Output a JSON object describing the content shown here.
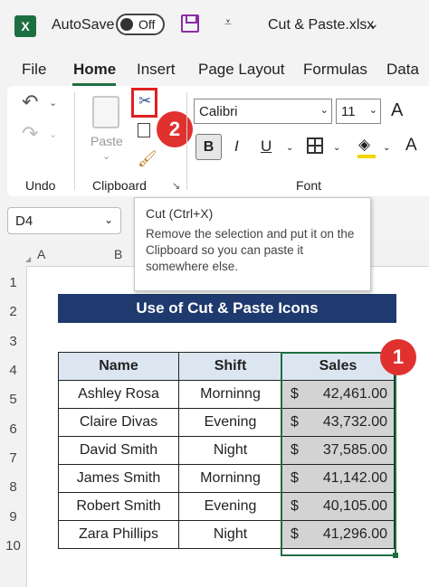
{
  "titlebar": {
    "app_icon": "excel-logo",
    "autosave_label": "AutoSave",
    "autosave_state": "Off",
    "filename": "Cut & Paste.xlsx"
  },
  "menu": {
    "tabs": [
      "File",
      "Home",
      "Insert",
      "Page Layout",
      "Formulas",
      "Data"
    ],
    "active": "Home"
  },
  "ribbon": {
    "undo_group_label": "Undo",
    "clipboard_group_label": "Clipboard",
    "font_group_label": "Font",
    "paste_label": "Paste",
    "font_name": "Calibri",
    "font_size": "11",
    "bold": "B",
    "italic": "I",
    "underline": "U",
    "grow_font": "A",
    "font_color": "A",
    "icons": [
      "undo-icon",
      "redo-icon",
      "paste-icon",
      "cut-icon",
      "copy-icon",
      "format-painter-icon",
      "borders-icon",
      "fill-color-icon",
      "dialog-launcher-icon"
    ]
  },
  "badges": {
    "cut_step": "2",
    "selection_step": "1"
  },
  "tooltip": {
    "title": "Cut (Ctrl+X)",
    "description": "Remove the selection and put it on the Clipboard so you can paste it somewhere else."
  },
  "namebox": {
    "value": "D4"
  },
  "columns": [
    "A",
    "B"
  ],
  "rows": [
    "1",
    "2",
    "3",
    "4",
    "5",
    "6",
    "7",
    "8",
    "9",
    "10"
  ],
  "sheet": {
    "title": "Use of Cut & Paste Icons",
    "headers": [
      "Name",
      "Shift",
      "Sales"
    ],
    "rows": [
      {
        "name": "Ashley Rosa",
        "shift": "Morninng",
        "currency": "$",
        "sales": "42,461.00"
      },
      {
        "name": "Claire Divas",
        "shift": "Evening",
        "currency": "$",
        "sales": "43,732.00"
      },
      {
        "name": "David Smith",
        "shift": "Night",
        "currency": "$",
        "sales": "37,585.00"
      },
      {
        "name": "James Smith",
        "shift": "Morninng",
        "currency": "$",
        "sales": "41,142.00"
      },
      {
        "name": "Robert Smith",
        "shift": "Evening",
        "currency": "$",
        "sales": "40,105.00"
      },
      {
        "name": "Zara Phillips",
        "shift": "Night",
        "currency": "$",
        "sales": "41,296.00"
      }
    ]
  },
  "colors": {
    "excel_green": "#1d6f42",
    "title_fill": "#1f3a6e",
    "header_fill": "#dce6f1",
    "sales_fill": "#d3d3d3",
    "badge": "#e0312f"
  }
}
